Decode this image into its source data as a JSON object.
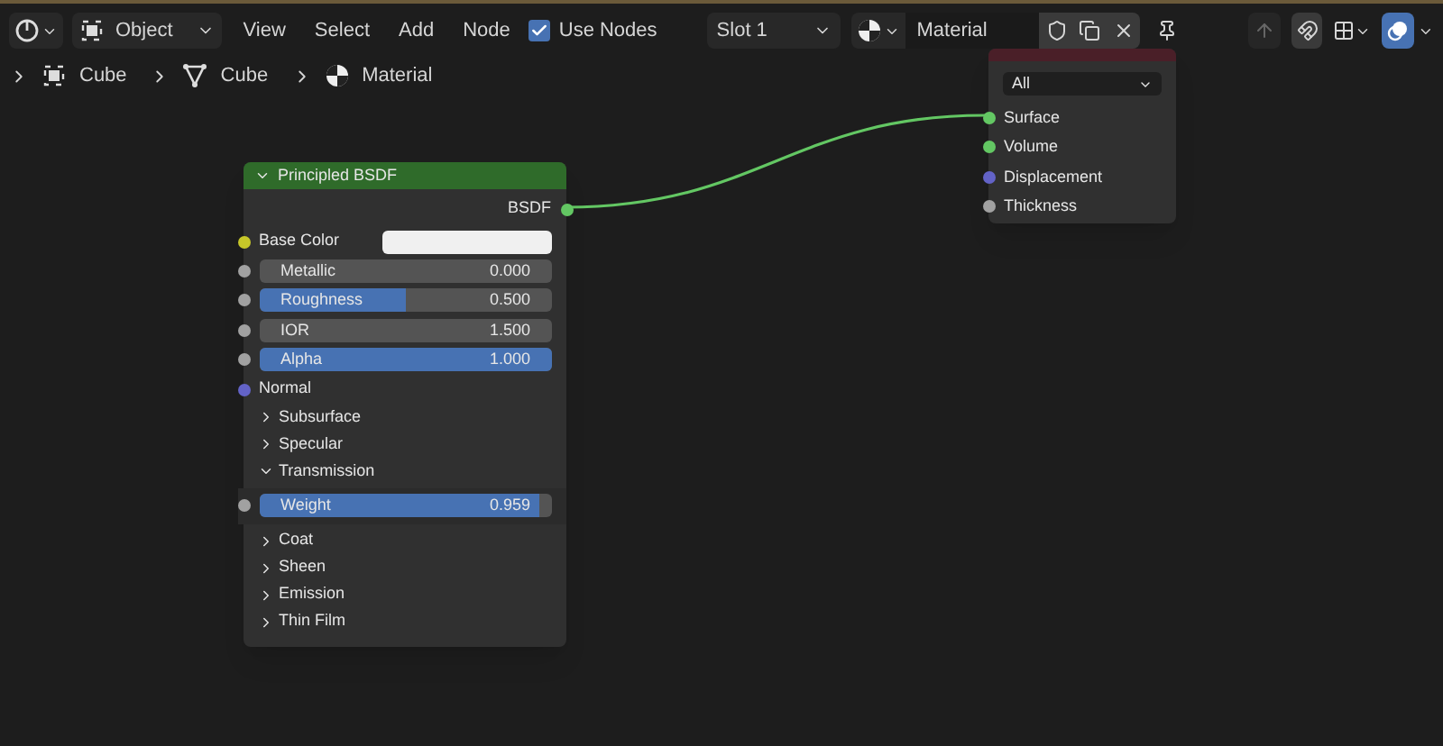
{
  "header": {
    "mode": "Object",
    "menus": [
      "View",
      "Select",
      "Add",
      "Node"
    ],
    "use_nodes": {
      "label": "Use Nodes",
      "checked": true
    },
    "slot": "Slot 1",
    "material": "Material"
  },
  "breadcrumbs": [
    {
      "label": "Cube",
      "kind": "object"
    },
    {
      "label": "Cube",
      "kind": "mesh"
    },
    {
      "label": "Material",
      "kind": "material"
    }
  ],
  "principled_node": {
    "title": "Principled BSDF",
    "expanded": true,
    "output": "BSDF",
    "inputs": [
      {
        "kind": "color",
        "label": "Base Color",
        "color": "#c7c729"
      },
      {
        "kind": "slider",
        "label": "Metallic",
        "value": "0.000",
        "level": 0,
        "color": "#a1a1a1"
      },
      {
        "kind": "slider",
        "label": "Roughness",
        "value": "0.500",
        "level": 0.5,
        "color": "#a1a1a1"
      },
      {
        "kind": "number",
        "label": "IOR",
        "value": "1.500",
        "color": "#a1a1a1"
      },
      {
        "kind": "slider",
        "label": "Alpha",
        "value": "1.000",
        "level": 1,
        "color": "#a1a1a1"
      },
      {
        "kind": "socket",
        "label": "Normal",
        "color": "#6363c7"
      },
      {
        "kind": "panel",
        "label": "Subsurface",
        "expanded": false
      },
      {
        "kind": "panel",
        "label": "Specular",
        "expanded": false
      },
      {
        "kind": "panel",
        "label": "Transmission",
        "expanded": true,
        "children": [
          {
            "kind": "slider",
            "label": "Weight",
            "value": "0.959",
            "level": 0.959,
            "color": "#a1a1a1"
          }
        ]
      },
      {
        "kind": "panel",
        "label": "Coat",
        "expanded": false
      },
      {
        "kind": "panel",
        "label": "Sheen",
        "expanded": false
      },
      {
        "kind": "panel",
        "label": "Emission",
        "expanded": false
      },
      {
        "kind": "panel",
        "label": "Thin Film",
        "expanded": false
      }
    ]
  },
  "output_node": {
    "target": "All",
    "inputs": [
      {
        "label": "Surface",
        "color": "#63c763"
      },
      {
        "label": "Volume",
        "color": "#63c763"
      },
      {
        "label": "Displacement",
        "color": "#6363c7"
      },
      {
        "label": "Thickness",
        "color": "#a1a1a1"
      }
    ]
  }
}
